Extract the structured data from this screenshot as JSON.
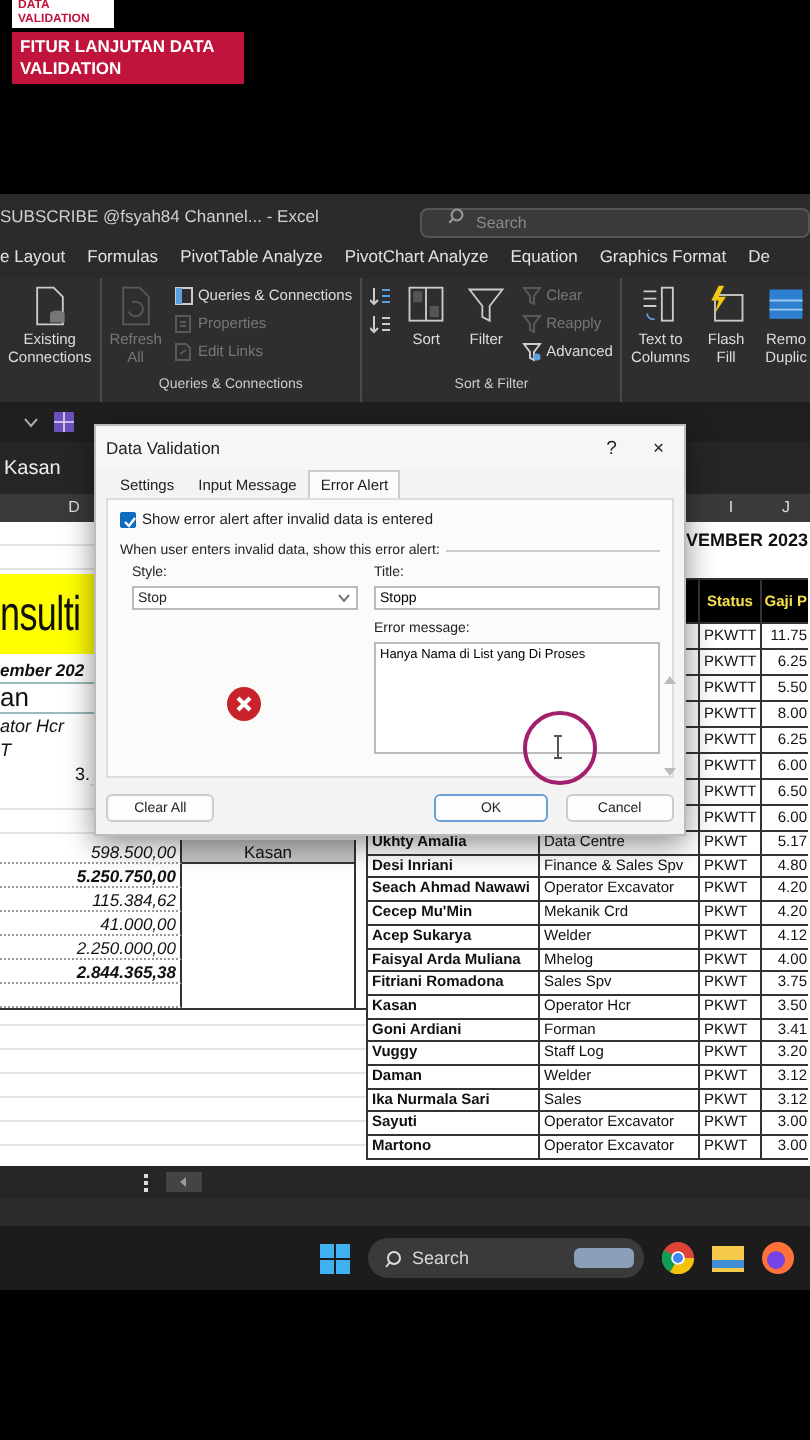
{
  "video_overlay": {
    "tag": "DATA VALIDATION",
    "headline": "FITUR LANJUTAN DATA VALIDATION"
  },
  "window": {
    "title": "SUBSCRIBE @fsyah84 Channel... - Excel",
    "search": {
      "placeholder": "Search"
    }
  },
  "ribbon_tabs": [
    {
      "label": "e Layout",
      "selected": false
    },
    {
      "label": "Formulas",
      "selected": false
    },
    {
      "label": "PivotTable Analyze",
      "selected": false
    },
    {
      "label": "PivotChart Analyze",
      "selected": false
    },
    {
      "label": "Equation",
      "selected": false
    },
    {
      "label": "Graphics Format",
      "selected": false
    },
    {
      "label": "De",
      "selected": false
    }
  ],
  "ribbon_groups": [
    {
      "items": [
        {
          "kind": "large",
          "label": "Existing Connections",
          "disabled": false
        }
      ]
    },
    {
      "label": "Queries & Connections",
      "items": [
        {
          "kind": "large",
          "label": "Refresh All",
          "disabled": true
        },
        {
          "kind": "small",
          "label": "Queries & Connections",
          "disabled": false
        },
        {
          "kind": "small",
          "label": "Properties",
          "disabled": true
        },
        {
          "kind": "small",
          "label": "Edit Links",
          "disabled": true
        }
      ]
    },
    {
      "label": "Sort & Filter",
      "items": [
        {
          "kind": "icon",
          "disabled": false
        },
        {
          "kind": "icon",
          "disabled": false
        },
        {
          "kind": "large",
          "label": "Sort",
          "disabled": false
        },
        {
          "kind": "large",
          "label": "Filter",
          "disabled": false
        },
        {
          "kind": "small",
          "label": "Clear",
          "disabled": true
        },
        {
          "kind": "small",
          "label": "Reapply",
          "disabled": true
        },
        {
          "kind": "small",
          "label": "Advanced",
          "disabled": false
        }
      ]
    },
    {
      "items": [
        {
          "kind": "large",
          "label": "Text to Columns",
          "disabled": false
        },
        {
          "kind": "large",
          "label": "Flash Fill",
          "disabled": false
        },
        {
          "kind": "large",
          "label": "Remo Duplic",
          "disabled": false
        }
      ]
    }
  ],
  "formula_bar": {
    "value": "Kasan"
  },
  "column_headers": [
    "D",
    "I",
    "J"
  ],
  "left_block": {
    "title_fragment": "nsulti",
    "subtitle": "ember 202",
    "name": "an",
    "position": "ator Hcr",
    "status": "T",
    "amount": "3."
  },
  "summary_rows": [
    {
      "amount": "598.500,00",
      "bold": false,
      "name": "Kasan"
    },
    {
      "amount": "5.250.750,00",
      "bold": true
    },
    {
      "amount": "115.384,62",
      "bold": false
    },
    {
      "amount": "41.000,00",
      "bold": false
    },
    {
      "amount": "2.250.000,00",
      "bold": false
    },
    {
      "amount": "2.844.365,38",
      "bold": true
    }
  ],
  "employee_table": {
    "heading": "VEMBER 2023",
    "columns": [
      "Status",
      "Gaji P"
    ],
    "rows": [
      {
        "status": "PKWTT",
        "salary": "11.75"
      },
      {
        "status": "PKWTT",
        "salary": "6.25"
      },
      {
        "status": "PKWTT",
        "salary": "5.50"
      },
      {
        "status": "PKWTT",
        "salary": "8.00"
      },
      {
        "status": "PKWTT",
        "salary": "6.25"
      },
      {
        "status": "PKWTT",
        "salary": "6.00"
      },
      {
        "status": "PKWTT",
        "salary": "6.50"
      },
      {
        "status": "PKWTT",
        "salary": "6.00"
      },
      {
        "name": "Ukhty Amalia",
        "job": "Data Centre",
        "status": "PKWT",
        "salary": "5.17"
      },
      {
        "name": "Desi Inriani",
        "job": "Finance & Sales Spv",
        "status": "PKWT",
        "salary": "4.80"
      },
      {
        "name": "Seach Ahmad Nawawi",
        "job": "Operator Excavator",
        "status": "PKWT",
        "salary": "4.20"
      },
      {
        "name": "Cecep Mu'Min",
        "job": "Mekanik Crd",
        "status": "PKWT",
        "salary": "4.20"
      },
      {
        "name": "Acep Sukarya",
        "job": "Welder",
        "status": "PKWT",
        "salary": "4.12"
      },
      {
        "name": "Faisyal Arda Muliana",
        "job": "Mhelog",
        "status": "PKWT",
        "salary": "4.00"
      },
      {
        "name": "Fitriani Romadona",
        "job": "Sales Spv",
        "status": "PKWT",
        "salary": "3.75"
      },
      {
        "name": "Kasan",
        "job": "Operator Hcr",
        "status": "PKWT",
        "salary": "3.50"
      },
      {
        "name": "Goni Ardiani",
        "job": "Forman",
        "status": "PKWT",
        "salary": "3.41"
      },
      {
        "name": "Vuggy",
        "job": "Staff Log",
        "status": "PKWT",
        "salary": "3.20"
      },
      {
        "name": "Daman",
        "job": "Welder",
        "status": "PKWT",
        "salary": "3.12"
      },
      {
        "name": "Ika Nurmala Sari",
        "job": "Sales",
        "status": "PKWT",
        "salary": "3.12"
      },
      {
        "name": "Sayuti",
        "job": "Operator Excavator",
        "status": "PKWT",
        "salary": "3.00"
      },
      {
        "name": "Martono",
        "job": "Operator Excavator",
        "status": "PKWT",
        "salary": "3.00"
      }
    ]
  },
  "dialog": {
    "title": "Data Validation",
    "help": "?",
    "close": "×",
    "tabs": [
      {
        "label": "Settings",
        "selected": false
      },
      {
        "label": "Input Message",
        "selected": false
      },
      {
        "label": "Error Alert",
        "selected": true
      }
    ],
    "show_alert": {
      "label": "Show error alert after invalid data is entered",
      "checked": true
    },
    "instruction": "When user enters invalid data, show this error alert:",
    "style": {
      "label": "Style:",
      "value": "Stop"
    },
    "title_field": {
      "label": "Title:",
      "value": "Stopp"
    },
    "message": {
      "label": "Error message:",
      "value": "Hanya Nama di List yang Di Proses"
    },
    "buttons": [
      {
        "label": "Clear All",
        "kind": "secondary"
      },
      {
        "label": "OK",
        "kind": "default"
      },
      {
        "label": "Cancel",
        "kind": "secondary"
      }
    ]
  },
  "taskbar": {
    "search": {
      "placeholder": "Search"
    }
  }
}
